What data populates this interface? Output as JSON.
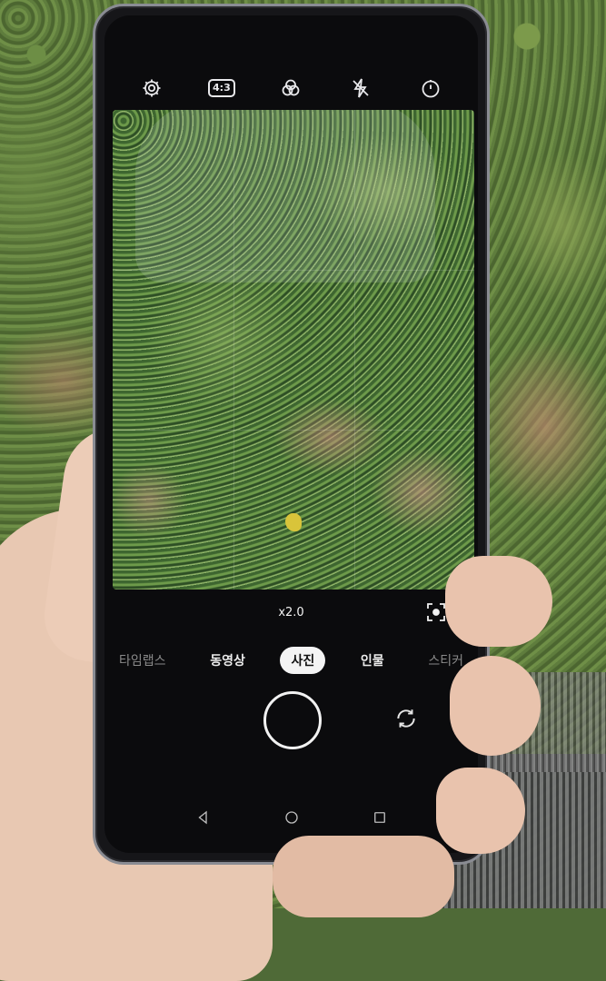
{
  "camera_toolbar": {
    "settings_icon": "gear-icon",
    "aspect_ratio": "4:3",
    "filter_icon": "filter-circles-icon",
    "flash_icon": "flash-off-icon",
    "timer_icon": "timer-icon"
  },
  "viewfinder": {
    "subject": "ivy-wall"
  },
  "controls": {
    "zoom_level": "x2.0",
    "modes": [
      {
        "label": "타임랩스"
      },
      {
        "label": "동영상"
      },
      {
        "label": "사진"
      },
      {
        "label": "인물"
      },
      {
        "label": "스티커"
      }
    ],
    "active_mode": "사진"
  },
  "nav": {
    "back_icon": "back-triangle-icon",
    "home_icon": "home-circle-icon",
    "recents_icon": "recents-square-icon"
  },
  "colors": {
    "active_mode_bg": "#f4f4f4",
    "screen_bg": "#0b0b0d"
  }
}
